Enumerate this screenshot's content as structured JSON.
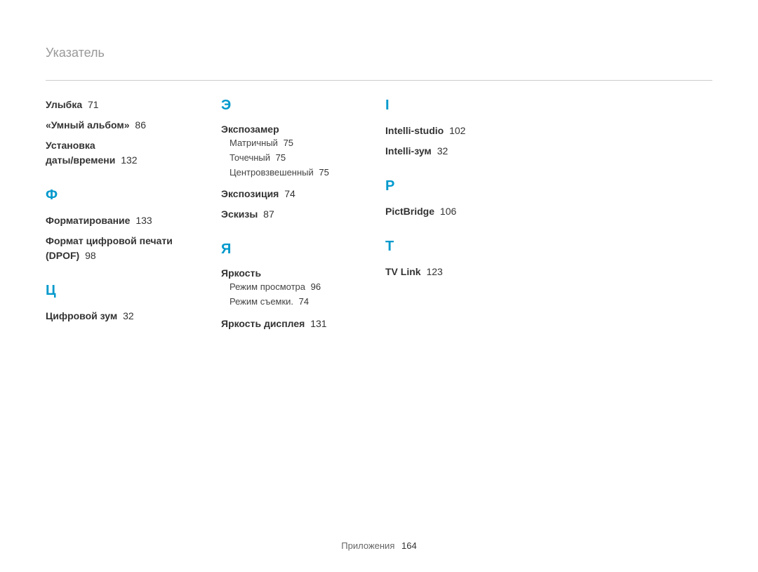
{
  "title": "Указатель",
  "footer": {
    "label": "Приложения",
    "page": "164"
  },
  "col1": {
    "smile": {
      "t": "Улыбка",
      "p": "71"
    },
    "smartAlbum": {
      "t": "«Умный альбом»",
      "p": "86"
    },
    "dateTime1": "Установка",
    "dateTime2": "даты/времени",
    "dateTimeP": "132",
    "letF": "Ф",
    "format": {
      "t": "Форматирование",
      "p": "133"
    },
    "dpof1": "Формат цифровой печати",
    "dpof2": "(DPOF)",
    "dpofP": "98",
    "letTs": "Ц",
    "dzoom": {
      "t": "Цифровой зум",
      "p": "32"
    }
  },
  "col2": {
    "letE": "Э",
    "expo": {
      "t": "Экспозамер",
      "matrix": {
        "t": "Матричный",
        "p": "75"
      },
      "spot": {
        "t": "Точечный",
        "p": "75"
      },
      "center": {
        "t": "Центровзвешенный",
        "p": "75"
      }
    },
    "exposure": {
      "t": "Экспозиция",
      "p": "74"
    },
    "thumbs": {
      "t": "Эскизы",
      "p": "87"
    },
    "letYa": "Я",
    "bright": {
      "t": "Яркость",
      "view": {
        "t": "Режим просмотра",
        "p": "96"
      },
      "shoot": {
        "t": "Режим съемки.",
        "p": "74"
      }
    },
    "dispBright": {
      "t": "Яркость дисплея",
      "p": "131"
    }
  },
  "col3": {
    "letI": "I",
    "istudio": {
      "t": "Intelli-studio",
      "p": "102"
    },
    "izoom": {
      "t": "Intelli-зум",
      "p": "32"
    },
    "letP": "P",
    "pict": {
      "t": "PictBridge",
      "p": "106"
    },
    "letT": "T",
    "tv": {
      "t": "TV Link",
      "p": "123"
    }
  }
}
